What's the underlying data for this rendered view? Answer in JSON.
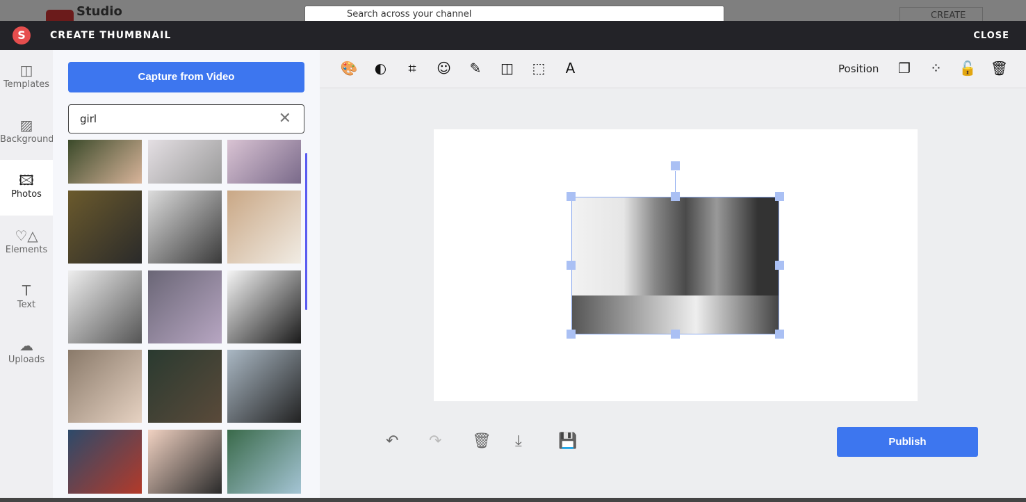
{
  "background_app": {
    "brand": "Studio",
    "search_placeholder": "Search across your channel",
    "create_label": "CREATE"
  },
  "header": {
    "logo": "S",
    "title": "CREATE THUMBNAIL",
    "close_label": "CLOSE"
  },
  "sidebar": {
    "items": [
      {
        "label": "Templates",
        "icon": "layout-icon",
        "glyph": "◫"
      },
      {
        "label": "Background",
        "icon": "stripes-icon",
        "glyph": "▨"
      },
      {
        "label": "Photos",
        "icon": "image-icon",
        "glyph": "🖾",
        "active": true
      },
      {
        "label": "Elements",
        "icon": "shapes-icon",
        "glyph": "♡△"
      },
      {
        "label": "Text",
        "icon": "text-icon",
        "glyph": "T"
      },
      {
        "label": "Uploads",
        "icon": "cloud-upload-icon",
        "glyph": "☁"
      }
    ]
  },
  "panel": {
    "capture_label": "Capture from Video",
    "search_value": "girl",
    "clear_icon": "close-icon",
    "thumbnails": [
      [
        "#3b4a2a",
        "#d8b49a"
      ],
      [
        "#e4dfe3",
        "#9a9a9a"
      ],
      [
        "#d9c3d3",
        "#7a6a8a"
      ],
      [
        "#6b5a2c",
        "#2a2a2a"
      ],
      [
        "#dcdcdc",
        "#3a3a3a"
      ],
      [
        "#c9a785",
        "#f1ece4"
      ],
      [
        "#eeeeee",
        "#555555"
      ],
      [
        "#6a6676",
        "#b7a6c2"
      ],
      [
        "#f5f5f5",
        "#1a1a1a"
      ],
      [
        "#8a7a6a",
        "#e6d2c2"
      ],
      [
        "#2a3a30",
        "#5a4a3a"
      ],
      [
        "#aab8c4",
        "#222222"
      ],
      [
        "#2d4a6a",
        "#b33a2a"
      ],
      [
        "#f1d2c2",
        "#2a2a2a"
      ],
      [
        "#3a6a4a",
        "#a4c4d4"
      ]
    ]
  },
  "toolbar": {
    "tools": [
      {
        "name": "palette-icon",
        "glyph": "🎨"
      },
      {
        "name": "brightness-icon",
        "glyph": "◐"
      },
      {
        "name": "crop-icon",
        "glyph": "⌗"
      },
      {
        "name": "face-icon",
        "glyph": "☺"
      },
      {
        "name": "brush-icon",
        "glyph": "✎"
      },
      {
        "name": "flip-icon",
        "glyph": "◫"
      },
      {
        "name": "select-area-icon",
        "glyph": "⬚"
      },
      {
        "name": "text-color-icon",
        "glyph": "A"
      }
    ],
    "position_label": "Position",
    "right_tools": [
      {
        "name": "copy-icon",
        "glyph": "❐"
      },
      {
        "name": "transparency-icon",
        "glyph": "⁘"
      },
      {
        "name": "unlock-icon",
        "glyph": "🔓"
      },
      {
        "name": "delete-icon",
        "glyph": "🗑"
      }
    ]
  },
  "bottom": {
    "actions": [
      {
        "name": "undo-icon",
        "glyph": "↶"
      },
      {
        "name": "redo-icon",
        "glyph": "↷"
      },
      {
        "name": "delete-icon",
        "glyph": "🗑"
      },
      {
        "name": "download-icon",
        "glyph": "⤓"
      },
      {
        "name": "save-icon",
        "glyph": "💾"
      }
    ],
    "publish_label": "Publish"
  },
  "colors": {
    "accent": "#3d76ef",
    "header": "#232328",
    "logo": "#e64e4e",
    "scrollbar": "#5a5cf0",
    "handle": "#aac0f4"
  }
}
